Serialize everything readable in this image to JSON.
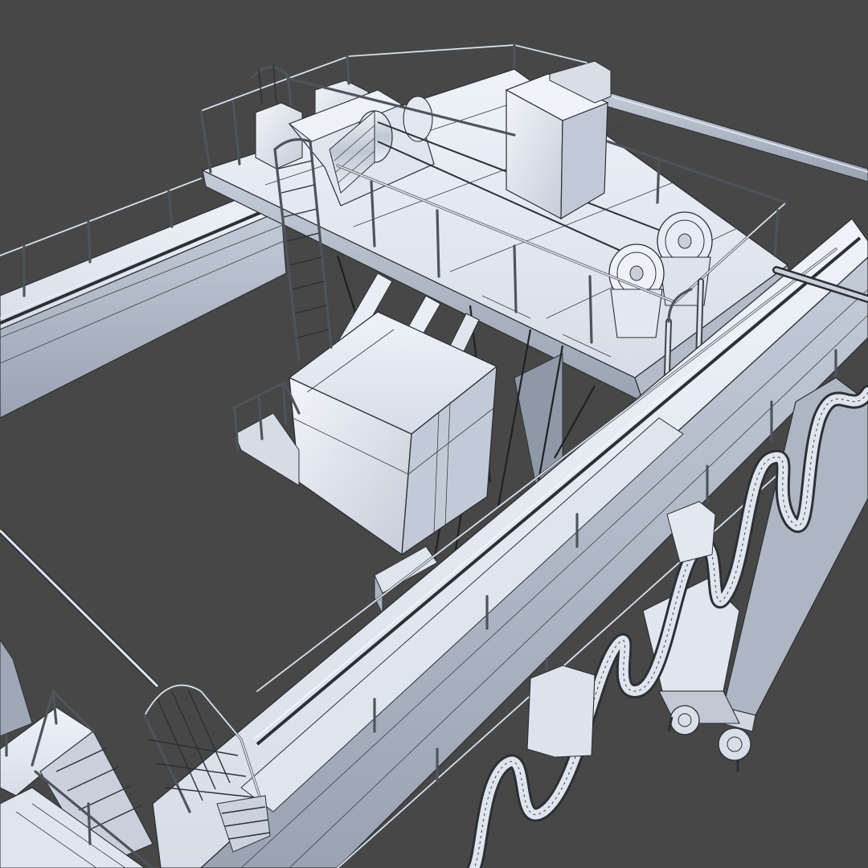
{
  "scene": {
    "subject": "",
    "colors": {
      "background": "#474747",
      "model_light": "#e6ebf4",
      "model_mid": "#c9d0dc",
      "model_dark": "#9ea7b5",
      "wireframe": "#2b3035"
    }
  }
}
